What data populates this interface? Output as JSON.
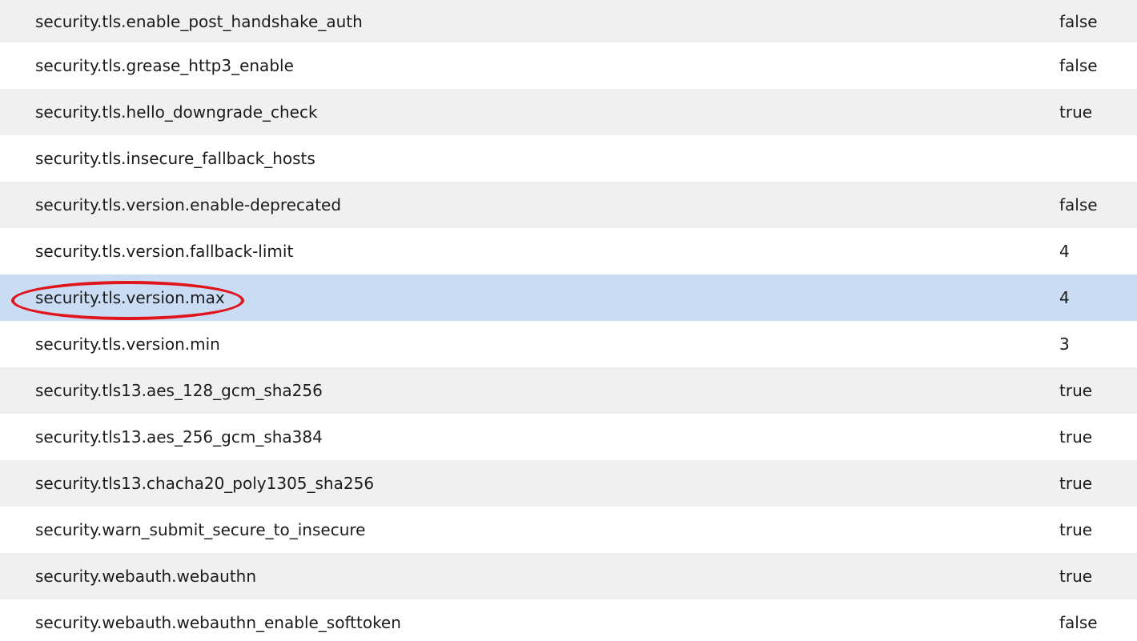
{
  "preferences": [
    {
      "name": "security.tls.enable_post_handshake_auth",
      "value": "false",
      "selected": false
    },
    {
      "name": "security.tls.grease_http3_enable",
      "value": "false",
      "selected": false
    },
    {
      "name": "security.tls.hello_downgrade_check",
      "value": "true",
      "selected": false
    },
    {
      "name": "security.tls.insecure_fallback_hosts",
      "value": "",
      "selected": false
    },
    {
      "name": "security.tls.version.enable-deprecated",
      "value": "false",
      "selected": false
    },
    {
      "name": "security.tls.version.fallback-limit",
      "value": "4",
      "selected": false
    },
    {
      "name": "security.tls.version.max",
      "value": "4",
      "selected": true
    },
    {
      "name": "security.tls.version.min",
      "value": "3",
      "selected": false
    },
    {
      "name": "security.tls13.aes_128_gcm_sha256",
      "value": "true",
      "selected": false
    },
    {
      "name": "security.tls13.aes_256_gcm_sha384",
      "value": "true",
      "selected": false
    },
    {
      "name": "security.tls13.chacha20_poly1305_sha256",
      "value": "true",
      "selected": false
    },
    {
      "name": "security.warn_submit_secure_to_insecure",
      "value": "true",
      "selected": false
    },
    {
      "name": "security.webauth.webauthn",
      "value": "true",
      "selected": false
    },
    {
      "name": "security.webauth.webauthn_enable_softtoken",
      "value": "false",
      "selected": false
    }
  ],
  "annotation": {
    "type": "ellipse",
    "color": "#e0141b",
    "target": "security.tls.version.max"
  },
  "colors": {
    "row_alt": "#f0f0f0",
    "row_selected": "#c9dcf3"
  }
}
